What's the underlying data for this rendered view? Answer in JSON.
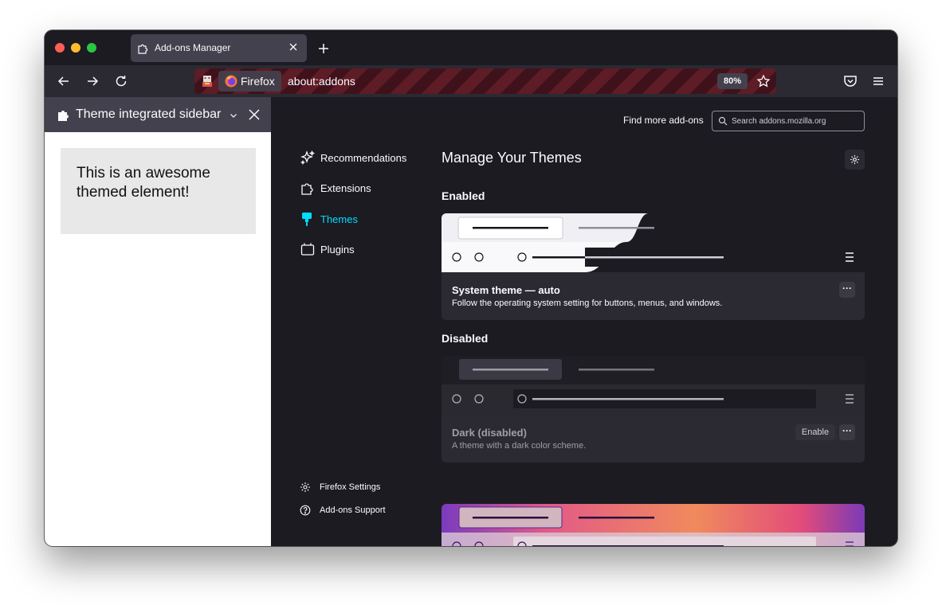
{
  "browser": {
    "tab": {
      "title": "Add-ons Manager"
    },
    "url": {
      "identity_label": "Firefox",
      "address": "about:addons",
      "zoom": "80%"
    }
  },
  "sidebar": {
    "title": "Theme integrated sidebar",
    "card_text": "This is an awesome themed element!"
  },
  "addons": {
    "find_more_label": "Find more add-ons",
    "search_placeholder": "Search addons.mozilla.org",
    "categories": [
      {
        "label": "Recommendations",
        "icon": "sparkle-icon"
      },
      {
        "label": "Extensions",
        "icon": "puzzle-icon"
      },
      {
        "label": "Themes",
        "icon": "paintbrush-icon",
        "active": true
      },
      {
        "label": "Plugins",
        "icon": "plugin-icon"
      }
    ],
    "footer_links": [
      {
        "label": "Firefox Settings",
        "icon": "gear-icon"
      },
      {
        "label": "Add-ons Support",
        "icon": "help-icon"
      }
    ],
    "heading": "Manage Your Themes",
    "enabled_heading": "Enabled",
    "disabled_heading": "Disabled",
    "themes": [
      {
        "name": "System theme — auto",
        "description": "Follow the operating system setting for buttons, menus, and windows."
      },
      {
        "name": "Dark (disabled)",
        "description": "A theme with a dark color scheme.",
        "action": "Enable"
      }
    ],
    "more_glyph": "···"
  },
  "colors": {
    "accent": "#00ddff",
    "chrome_bg": "#1c1b22",
    "toolbar_bg": "#2b2a33",
    "urlbar_stripe": "#5d1c26"
  }
}
